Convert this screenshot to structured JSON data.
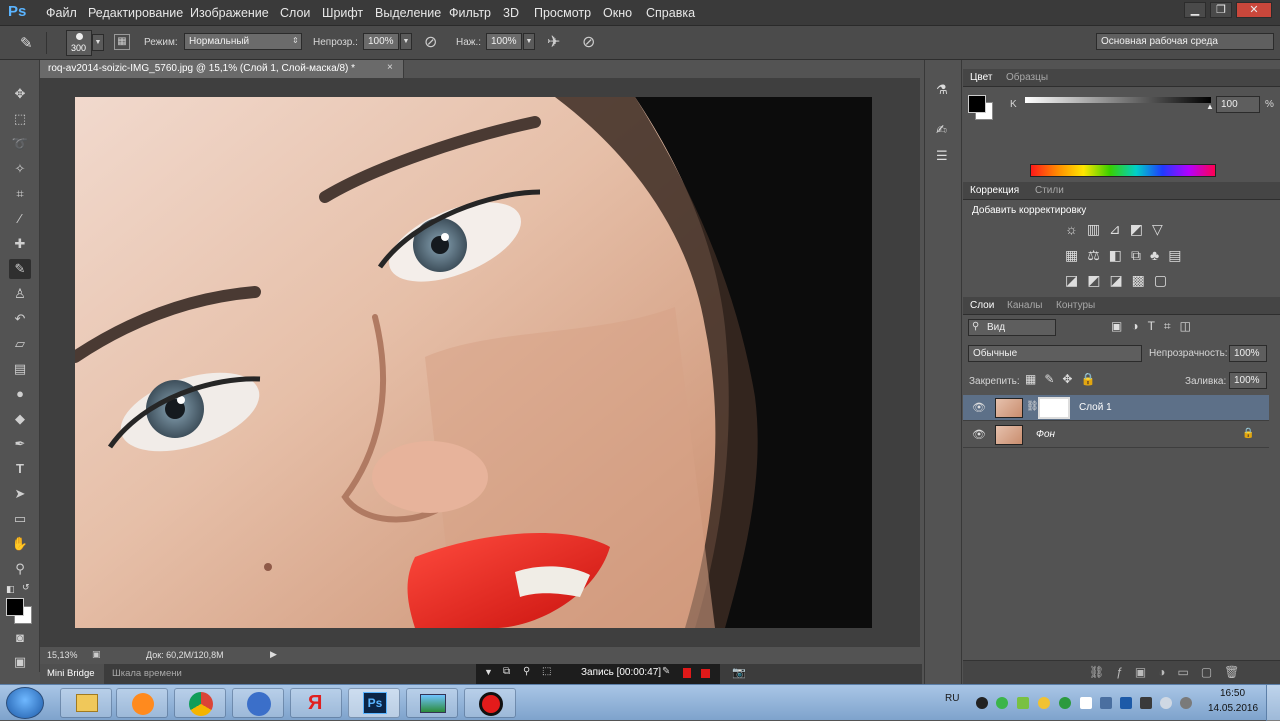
{
  "app": {
    "logo": "Ps"
  },
  "menu": [
    "Файл",
    "Редактирование",
    "Изображение",
    "Слои",
    "Шрифт",
    "Выделение",
    "Фильтр",
    "3D",
    "Просмотр",
    "Окно",
    "Справка"
  ],
  "options": {
    "brush_size": "300",
    "mode_label": "Режим:",
    "mode_value": "Нормальный",
    "opacity_label": "Непрозр.:",
    "opacity_value": "100%",
    "flow_label": "Наж.:",
    "flow_value": "100%",
    "workspace": "Основная рабочая среда"
  },
  "document": {
    "tab_title": "roq-av2014-soizic-IMG_5760.jpg @ 15,1% (Слой 1, Слой-маска/8) *",
    "zoom": "15,13%",
    "doc_info": "Док: 60,2M/120,8M"
  },
  "bottom": {
    "tab_minibridge": "Mini Bridge",
    "tab_timeline": "Шкала времени",
    "recording": "Запись [00:00:47]"
  },
  "color_panel": {
    "tab_color": "Цвет",
    "tab_swatches": "Образцы",
    "channel": "K",
    "value": "100",
    "unit": "%"
  },
  "adjustments": {
    "tab_correction": "Коррекция",
    "tab_styles": "Стили",
    "title": "Добавить корректировку"
  },
  "layers_panel": {
    "tab_layers": "Слои",
    "tab_channels": "Каналы",
    "tab_paths": "Контуры",
    "filter": "Вид",
    "blend_mode": "Обычные",
    "opacity_label": "Непрозрачность:",
    "opacity_value": "100%",
    "lock_label": "Закрепить:",
    "fill_label": "Заливка:",
    "fill_value": "100%",
    "layers": [
      {
        "name": "Слой 1"
      },
      {
        "name": "Фон"
      }
    ]
  },
  "taskbar": {
    "lang": "RU",
    "time": "16:50",
    "date": "14.05.2016",
    "apps": [
      "Ps"
    ]
  }
}
